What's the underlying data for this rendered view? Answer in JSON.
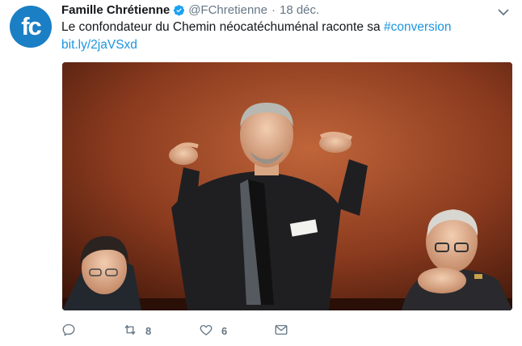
{
  "tweet": {
    "avatar_text": "fc",
    "author_name": "Famille Chrétienne",
    "handle": "@FChretienne",
    "separator": "·",
    "date": "18 déc.",
    "text_before": "Le confondateur du Chemin néocatéchuménal raconte sa ",
    "hashtag": "#conversion",
    "link": "bit.ly/2jaVSxd",
    "retweet_count": "8",
    "like_count": "6"
  },
  "colors": {
    "accent": "#1b95e0",
    "muted": "#657786",
    "avatar_bg": "#1a7fc4"
  },
  "icons": {
    "verified": "verified-badge-icon",
    "caret": "chevron-down-icon",
    "reply": "reply-icon",
    "retweet": "retweet-icon",
    "like": "heart-icon",
    "dm": "envelope-icon"
  }
}
